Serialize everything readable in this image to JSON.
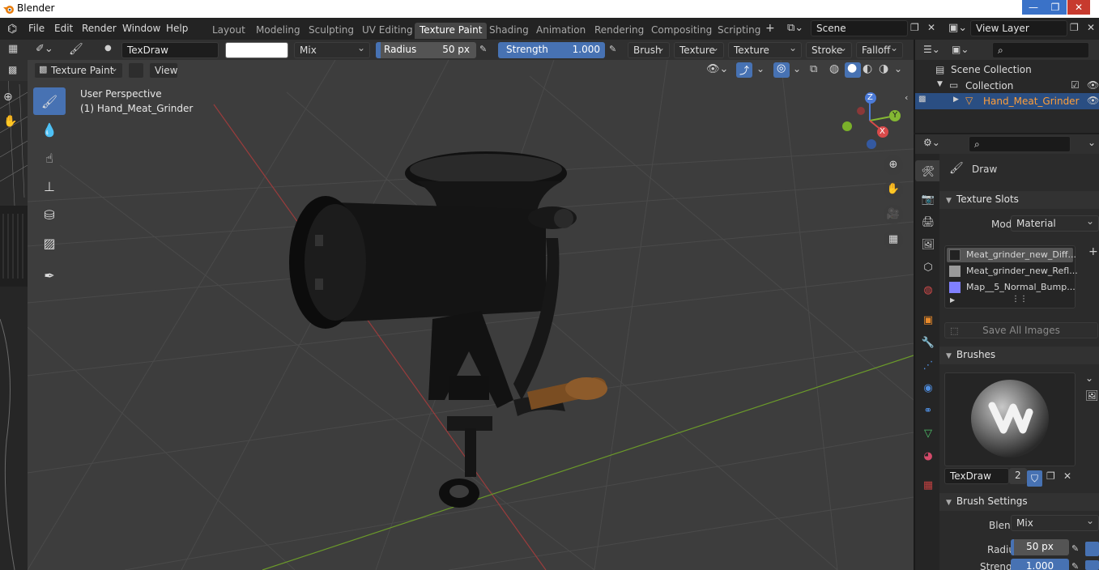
{
  "app": {
    "title": "Blender"
  },
  "colors": {
    "accent": "#4772b3",
    "selection": "#2a4e82",
    "highlight_text": "#ff9f3a",
    "bg": "#3d3d3d"
  },
  "menus": [
    "File",
    "Edit",
    "Render",
    "Window",
    "Help"
  ],
  "workspaces": [
    "Layout",
    "Modeling",
    "Sculpting",
    "UV Editing",
    "Texture Paint",
    "Shading",
    "Animation",
    "Rendering",
    "Compositing",
    "Scripting"
  ],
  "active_workspace": "Texture Paint",
  "scene": {
    "name": "Scene"
  },
  "view_layer": {
    "name": "View Layer"
  },
  "tool_header": {
    "brush_name": "TexDraw",
    "blend": "Mix",
    "radius_label": "Radius",
    "radius_value": "50 px",
    "strength_label": "Strength",
    "strength_value": "1.000",
    "menus": [
      "Brush",
      "Texture",
      "Texture Mask",
      "Stroke",
      "Falloff"
    ]
  },
  "viewport_header": {
    "mode": "Texture Paint",
    "view_menu": "View"
  },
  "viewport": {
    "perspective": "User Perspective",
    "object": "(1) Hand_Meat_Grinder"
  },
  "gizmo": {
    "x": "X",
    "y": "Y",
    "z": "Z"
  },
  "outliner": {
    "root": "Scene Collection",
    "collection": "Collection",
    "object": "Hand_Meat_Grinder"
  },
  "properties": {
    "tool_name": "Draw",
    "texture_slots": {
      "title": "Texture Slots",
      "mode_label": "Mode",
      "mode_value": "Material",
      "slots": [
        "Meat_grinder_new_Diff...",
        "Meat_grinder_new_Refl...",
        "Map__5_Normal_Bump..."
      ],
      "save_all": "Save All Images"
    },
    "brushes": {
      "title": "Brushes",
      "brush_name": "TexDraw",
      "users": "2"
    },
    "brush_settings": {
      "title": "Brush Settings",
      "blend_label": "Blend",
      "blend_value": "Mix",
      "radius_label": "Radius",
      "radius_value": "50 px",
      "strength_label": "Strength",
      "strength_value": "1.000"
    }
  }
}
